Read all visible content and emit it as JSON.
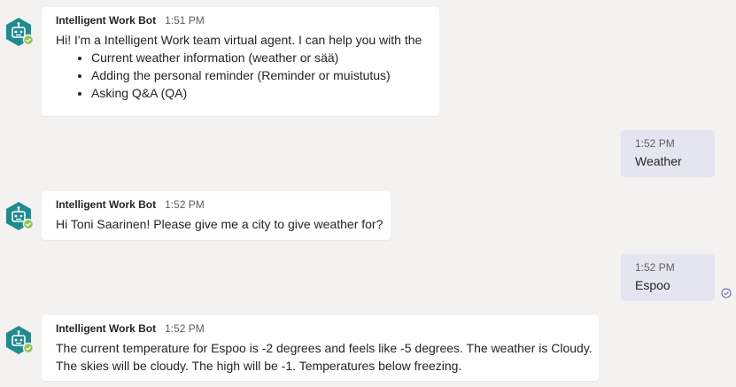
{
  "conversation": {
    "messages": [
      {
        "sender": "Intelligent Work Bot",
        "time": "1:51 PM",
        "text": "Hi! I'm a Intelligent Work team virtual agent. I can help you with the",
        "bullets": [
          "Current weather information (weather or sää)",
          "Adding the personal reminder (Reminder or muistutus)",
          "Asking Q&A (QA)"
        ]
      },
      {
        "time": "1:52 PM",
        "text": "Weather"
      },
      {
        "sender": "Intelligent Work Bot",
        "time": "1:52 PM",
        "text": "Hi Toni Saarinen! Please give me a city to give weather for?"
      },
      {
        "time": "1:52 PM",
        "text": "Espoo"
      },
      {
        "sender": "Intelligent Work Bot",
        "time": "1:52 PM",
        "lines": [
          "The current temperature for Espoo is -2 degrees and feels like -5 degrees. The weather is Cloudy.",
          "The skies will be cloudy. The high will be -1. Temperatures below freezing."
        ]
      }
    ]
  },
  "colors": {
    "background": "#f3f2f1",
    "incoming_bubble": "#ffffff",
    "outgoing_bubble": "#e5e5f1",
    "bot_avatar": "#1f8a8f",
    "presence_available": "#92c353",
    "read_receipt": "#6264a7"
  },
  "icons": {
    "bot_avatar": "bot-avatar-icon",
    "presence": "presence-available-icon",
    "read_receipt": "read-receipt-icon"
  }
}
